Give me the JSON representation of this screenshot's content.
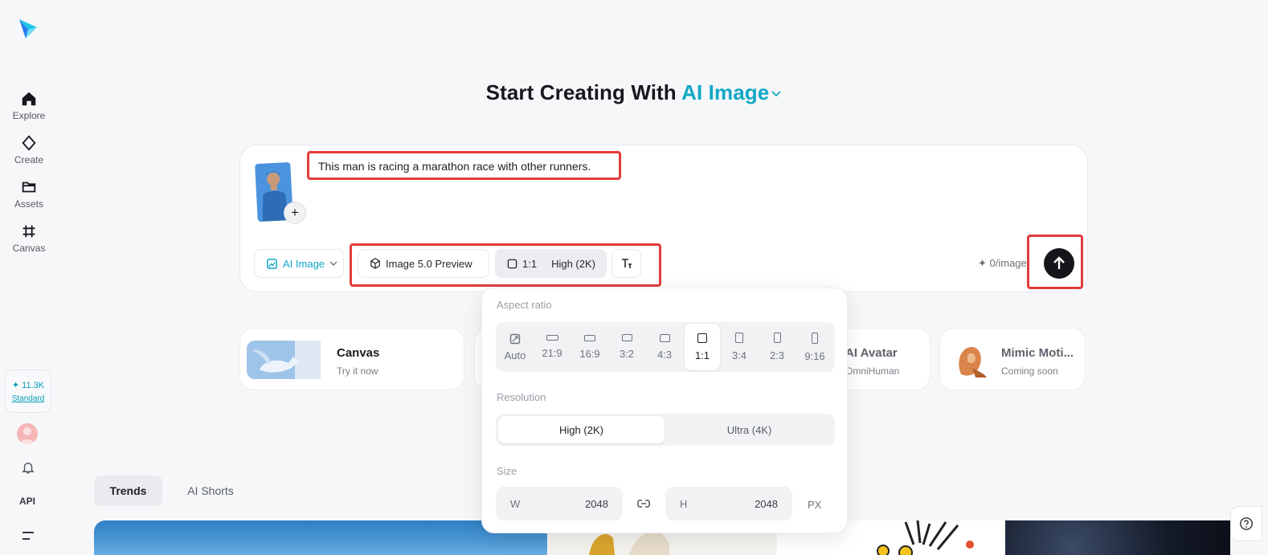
{
  "sidebar": {
    "items": [
      {
        "label": "Explore",
        "icon": "home-icon"
      },
      {
        "label": "Create",
        "icon": "diamond-icon"
      },
      {
        "label": "Assets",
        "icon": "folder-icon"
      },
      {
        "label": "Canvas",
        "icon": "grid-hash-icon"
      }
    ],
    "credits": "11.3K",
    "plan": "Standard",
    "api_label": "API"
  },
  "header": {
    "title_prefix": "Start Creating With",
    "title_accent": "AI Image"
  },
  "prompt": {
    "text": "This man is racing a marathon race with other runners.",
    "plus_label": "+"
  },
  "toolbar": {
    "mode_label": "AI Image",
    "model_label": "Image 5.0 Preview",
    "ratio_label": "1:1",
    "quality_label": "High (2K)",
    "credit_cost": "0/image"
  },
  "features": [
    {
      "title": "Canvas",
      "subtitle": "Try it now"
    },
    {
      "title": "AI Avatar",
      "subtitle": "OmniHuman"
    },
    {
      "title": "Mimic Moti...",
      "subtitle": "Coming soon"
    }
  ],
  "tabs": [
    {
      "label": "Trends"
    },
    {
      "label": "AI Shorts"
    }
  ],
  "popover": {
    "aspect_label": "Aspect ratio",
    "ratios": [
      "Auto",
      "21:9",
      "16:9",
      "3:2",
      "4:3",
      "1:1",
      "3:4",
      "2:3",
      "9:16"
    ],
    "selected_ratio": "1:1",
    "resolution_label": "Resolution",
    "resolutions": [
      "High (2K)",
      "Ultra (4K)"
    ],
    "selected_resolution": "High (2K)",
    "size_label": "Size",
    "width_key": "W",
    "width_value": "2048",
    "height_key": "H",
    "height_value": "2048",
    "unit": "PX"
  },
  "colors": {
    "accent": "#11a8c5",
    "highlight": "#e23b3b",
    "send_button": "#14161a"
  }
}
